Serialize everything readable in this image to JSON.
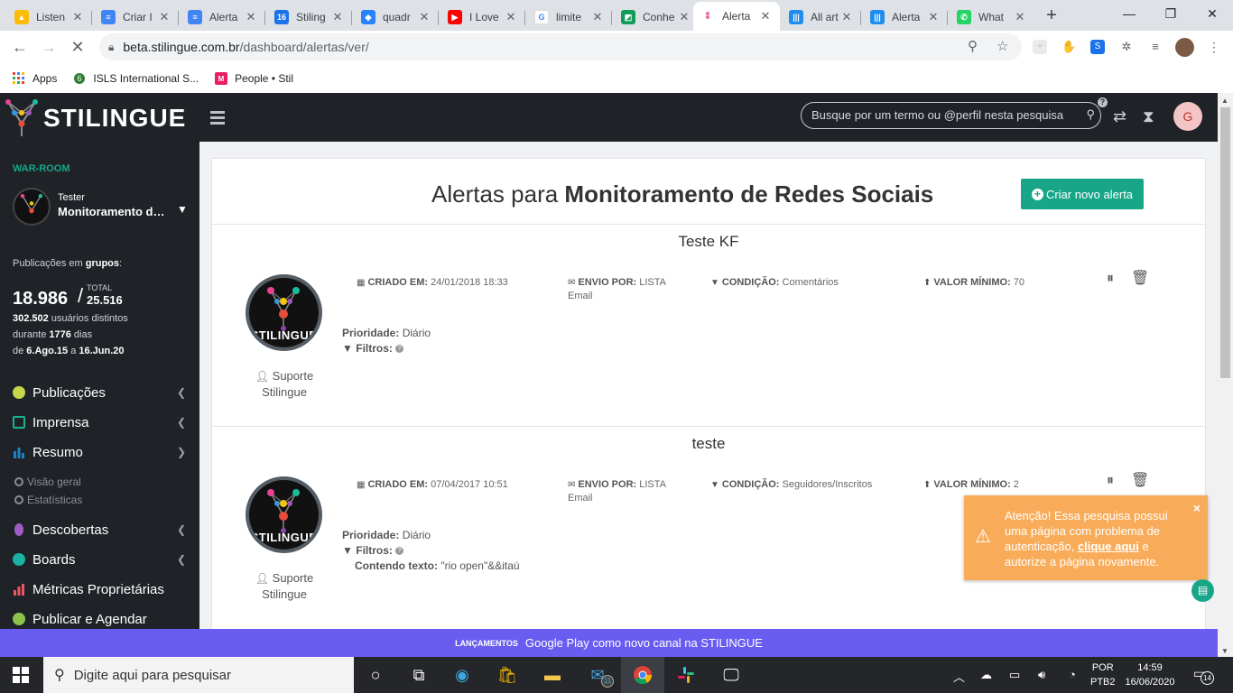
{
  "browser": {
    "tabs": [
      {
        "title": "Listen",
        "color": "#4285f4",
        "glyph": "▲"
      },
      {
        "title": "Criar I",
        "color": "#4285f4",
        "glyph": "≡"
      },
      {
        "title": "Alerta",
        "color": "#4285f4",
        "glyph": "≡"
      },
      {
        "title": "Stiling",
        "color": "#1a73e8",
        "glyph": "16"
      },
      {
        "title": "quadr",
        "color": "#2684ff",
        "glyph": "◆"
      },
      {
        "title": "I Love",
        "color": "#ff0000",
        "glyph": "▶"
      },
      {
        "title": "limite",
        "color": "#ffffff",
        "glyph": "G"
      },
      {
        "title": "Conhe",
        "color": "#0f9d58",
        "glyph": "◩"
      },
      {
        "title": "Alerta",
        "color": "#ffffff",
        "glyph": "⁑"
      },
      {
        "title": "All art",
        "color": "#1f8ded",
        "glyph": "|||"
      },
      {
        "title": "Alerta",
        "color": "#1f8ded",
        "glyph": "|||"
      },
      {
        "title": "What",
        "color": "#25d366",
        "glyph": "✆"
      }
    ],
    "url_host": "beta.stilingue.com.br",
    "url_path": "/dashboard/alertas/ver/",
    "bookmarks": [
      {
        "label": "Apps"
      },
      {
        "label": "ISLS International S..."
      },
      {
        "label": "People • Stil"
      }
    ]
  },
  "header": {
    "brand": "STILINGUE",
    "search_placeholder": "Busque por um termo ou @perfil nesta pesquisa",
    "avatar_letter": "G"
  },
  "sidebar": {
    "section": "WAR-ROOM",
    "user_role": "Tester",
    "user_project": "Monitoramento de Redes Sociais",
    "pubs_label_prefix": "Publicações em ",
    "pubs_label_bold": "grupos",
    "pubs_label_suffix": ":",
    "count": "18.986",
    "total_label": "TOTAL",
    "total": "25.516",
    "distinct_users": "302.502",
    "distinct_users_label": " usuários distintos",
    "during_prefix": "durante ",
    "days": "1776",
    "days_suffix": " dias",
    "from_prefix": "de ",
    "from": "6.Ago.15",
    "to_sep": " a ",
    "to": "16.Jun.20",
    "menu": [
      {
        "label": "Publicações",
        "color": "#c8d64a"
      },
      {
        "label": "Imprensa",
        "color": "#1ab394"
      },
      {
        "label": "Resumo",
        "color": "#1c84c6"
      },
      {
        "label": "Descobertas",
        "color": "#a05cc2"
      },
      {
        "label": "Boards",
        "color": "#1ab3a3"
      },
      {
        "label": "Métricas Proprietárias",
        "color": "#ed5565"
      },
      {
        "label": "Publicar e Agendar",
        "color": "#8bc34a"
      }
    ],
    "submenu": [
      {
        "label": "Visão geral"
      },
      {
        "label": "Estatísticas"
      }
    ]
  },
  "main": {
    "title_prefix": "Alertas para ",
    "title_bold": "Monitoramento de Redes Sociais",
    "new_alert_label": "Criar novo alerta",
    "alerts": [
      {
        "name": "Teste KF",
        "created_label": "CRIADO EM:",
        "created": "24/01/2018 18:33",
        "sent_label": "ENVIO POR:",
        "sent": "LISTA",
        "sent2": "Email",
        "condition_label": "CONDIÇÃO:",
        "condition": "Comentários",
        "min_label": "VALOR MÍNIMO:",
        "min": "70",
        "priority_label": "Prioridade:",
        "priority": "Diário",
        "filters_label": "Filtros:",
        "contains_label": "",
        "contains": "",
        "owner1": "Suporte",
        "owner2": "Stilingue"
      },
      {
        "name": "teste",
        "created_label": "CRIADO EM:",
        "created": "07/04/2017 10:51",
        "sent_label": "ENVIO POR:",
        "sent": "LISTA",
        "sent2": "Email",
        "condition_label": "CONDIÇÃO:",
        "condition": "Seguidores/Inscritos",
        "min_label": "VALOR MÍNIMO:",
        "min": "2",
        "priority_label": "Prioridade:",
        "priority": "Diário",
        "filters_label": "Filtros:",
        "contains_label": "Contendo texto:",
        "contains": "\"rio open\"&&itaú",
        "owner1": "Suporte",
        "owner2": "Stilingue"
      }
    ],
    "avatar_text": "STILINGUE"
  },
  "toast": {
    "text1": "Atenção! Essa pesquisa possui uma página com problema de autenticação, ",
    "link": "clique aqui",
    "text2": " e autorize a página novamente."
  },
  "announcement": {
    "tag": "LANÇAMENTOS",
    "text": "Google Play como novo canal na STILINGUE"
  },
  "taskbar": {
    "search_placeholder": "Digite aqui para pesquisar",
    "mail_badge": "11",
    "lang1": "POR",
    "lang2": "PTB2",
    "time": "14:59",
    "date": "16/06/2020",
    "notifications": "14"
  }
}
